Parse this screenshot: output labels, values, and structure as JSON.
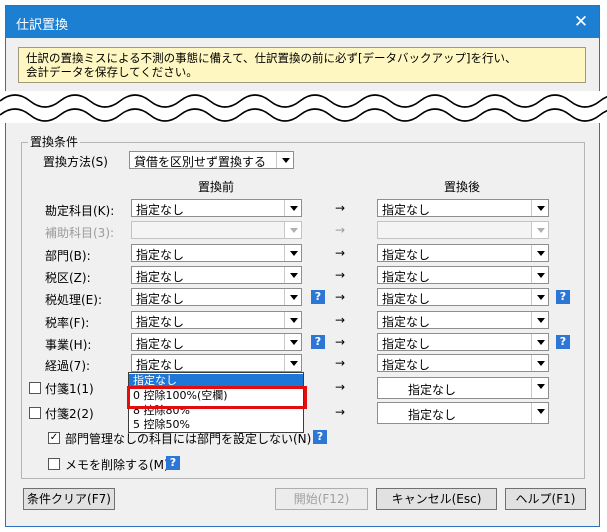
{
  "window": {
    "title": "仕訳置換",
    "close": "✕"
  },
  "notice": {
    "line1": "仕訳の置換ミスによる不測の事態に備えて、仕訳置換の前に必ず[データバックアップ]を行い、",
    "line2": "会計データを保存してください。"
  },
  "group": {
    "title": "置換条件"
  },
  "method": {
    "label": "置換方法(S)",
    "value": "貸借を区別せず置換する"
  },
  "headers": {
    "before": "置換前",
    "after": "置換後"
  },
  "rows": [
    {
      "label": "勘定科目(K):",
      "before": "指定なし",
      "after": "指定なし",
      "arrow": "→"
    },
    {
      "label": "補助科目(3):",
      "before": "",
      "after": "",
      "arrow": "→"
    },
    {
      "label": "部門(B):",
      "before": "指定なし",
      "after": "指定なし",
      "arrow": "→"
    },
    {
      "label": "税区(Z):",
      "before": "指定なし",
      "after": "指定なし",
      "arrow": "→"
    },
    {
      "label": "税処理(E):",
      "before": "指定なし",
      "after": "指定なし",
      "arrow": "→",
      "help": "?"
    },
    {
      "label": "税率(F):",
      "before": "指定なし",
      "after": "指定なし",
      "arrow": "→"
    },
    {
      "label": "事業(H):",
      "before": "指定なし",
      "after": "指定なし",
      "arrow": "→",
      "help": "?"
    },
    {
      "label": "経過(7):",
      "before": "指定なし",
      "after": "指定なし",
      "arrow": "→"
    }
  ],
  "dropdown": {
    "options": [
      "指定なし",
      "0 控除100%(空欄)",
      "8 控除80%",
      "5 控除50%"
    ]
  },
  "fusen": [
    {
      "label": "付箋1(1)",
      "arrow": "→",
      "after": "指定なし"
    },
    {
      "label": "付箋2(2)",
      "arrow": "→",
      "after": "指定なし"
    }
  ],
  "options": {
    "bumon": {
      "label": "部門管理なしの科目には部門を設定しない(N)",
      "checked": "✓",
      "help": "?"
    },
    "memo": {
      "label": "メモを削除する(M)",
      "help": "?"
    }
  },
  "buttons": {
    "clear": "条件クリア(F7)",
    "start": "開始(F12)",
    "cancel": "キャンセル(Esc)",
    "help": "ヘルプ(F1)"
  }
}
